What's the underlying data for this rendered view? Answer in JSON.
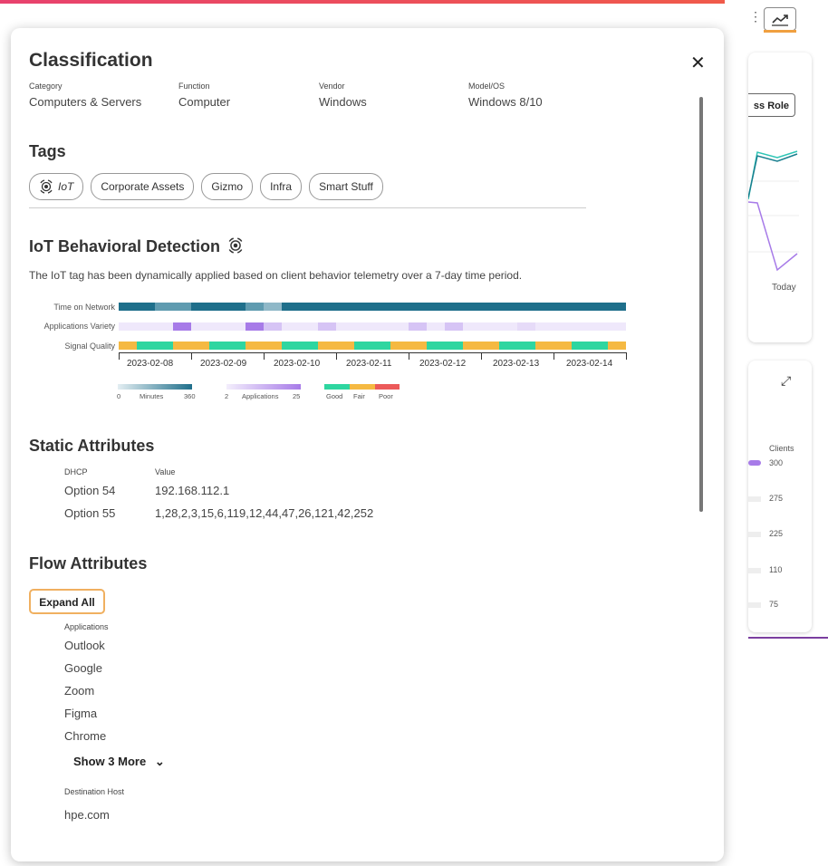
{
  "modal": {
    "classification": {
      "title": "Classification",
      "fields": [
        {
          "label": "Category",
          "value": "Computers & Servers"
        },
        {
          "label": "Function",
          "value": "Computer"
        },
        {
          "label": "Vendor",
          "value": "Windows"
        },
        {
          "label": "Model/OS",
          "value": "Windows 8/10"
        }
      ]
    },
    "tags": {
      "title": "Tags",
      "items": [
        "IoT",
        "Corporate Assets",
        "Gizmo",
        "Infra",
        "Smart Stuff"
      ]
    },
    "iot": {
      "title": "IoT Behavioral Detection",
      "description": "The IoT tag has been dynamically applied based on client behavior telemetry over a 7-day time period.",
      "rows": [
        "Time on Network",
        "Applications Variety",
        "Signal Quality"
      ],
      "dates": [
        "2023-02-08",
        "2023-02-09",
        "2023-02-10",
        "2023-02-11",
        "2023-02-12",
        "2023-02-13",
        "2023-02-14"
      ],
      "legend": {
        "minutes_min": "0",
        "minutes_label": "Minutes",
        "minutes_max": "360",
        "apps_min": "2",
        "apps_label": "Applications",
        "apps_max": "25",
        "good": "Good",
        "fair": "Fair",
        "poor": "Poor"
      },
      "colors": {
        "network": "#1f6f8b",
        "apps": "#a77be8",
        "good": "#2ed6a0",
        "fair": "#f5b942",
        "poor": "#ec5a5a"
      }
    },
    "static": {
      "title": "Static Attributes",
      "col1": "DHCP",
      "col2": "Value",
      "rows": [
        {
          "key": "Option 54",
          "value": "192.168.112.1"
        },
        {
          "key": "Option 55",
          "value": "1,28,2,3,15,6,119,12,44,47,26,121,42,252"
        }
      ]
    },
    "flow": {
      "title": "Flow Attributes",
      "expand_label": "Expand All",
      "apps_label": "Applications",
      "apps": [
        "Outlook",
        "Google",
        "Zoom",
        "Figma",
        "Chrome"
      ],
      "show_more": "Show 3 More",
      "dest_label": "Destination Host",
      "dest": "hpe.com"
    }
  },
  "background": {
    "role_button": "ss Role",
    "today": "Today",
    "clients_label": "Clients",
    "client_values": [
      "300",
      "275",
      "225",
      "110",
      "75"
    ]
  }
}
